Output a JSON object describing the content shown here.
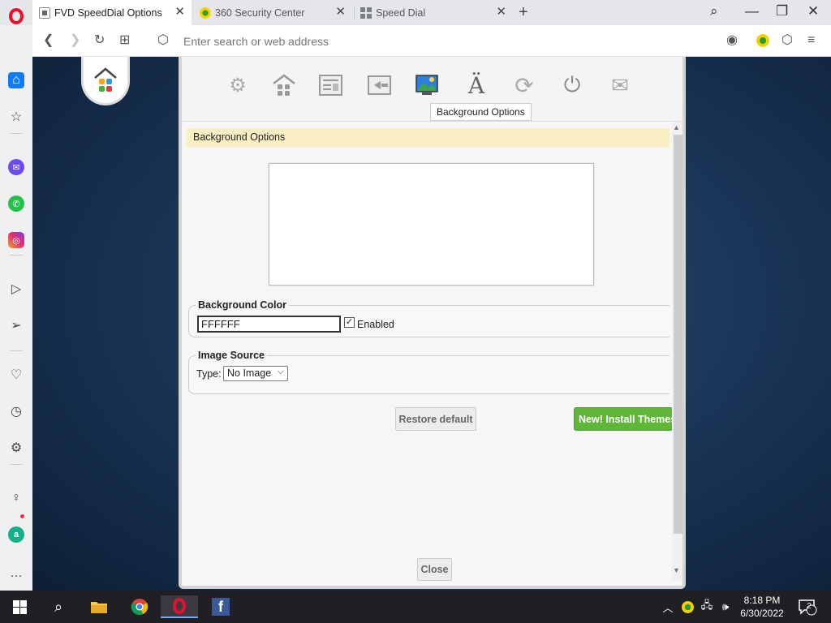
{
  "browser": {
    "tabs": [
      {
        "title": "FVD SpeedDial Options",
        "active": true
      },
      {
        "title": "360 Security Center",
        "active": false
      },
      {
        "title": "Speed Dial",
        "active": false
      }
    ],
    "address_placeholder": "Enter search or web address"
  },
  "options": {
    "tooltip": "Background Options",
    "section_title": "Background Options",
    "background_color": {
      "legend": "Background Color",
      "value": "FFFFFF",
      "enabled_label": "Enabled",
      "enabled": true
    },
    "image_source": {
      "legend": "Image Source",
      "type_label": "Type:",
      "type_value": "No Image"
    },
    "restore_label": "Restore default",
    "themes_label": "New! Install Themes",
    "close_label": "Close"
  },
  "taskbar": {
    "time": "8:18 PM",
    "date": "6/30/2022",
    "notification_count": "2"
  },
  "colors": {
    "accent_green": "#5fb639",
    "section_header_bg": "#faefc4",
    "opera_red": "#e8112d",
    "opera_blue": "#0f7cff"
  }
}
